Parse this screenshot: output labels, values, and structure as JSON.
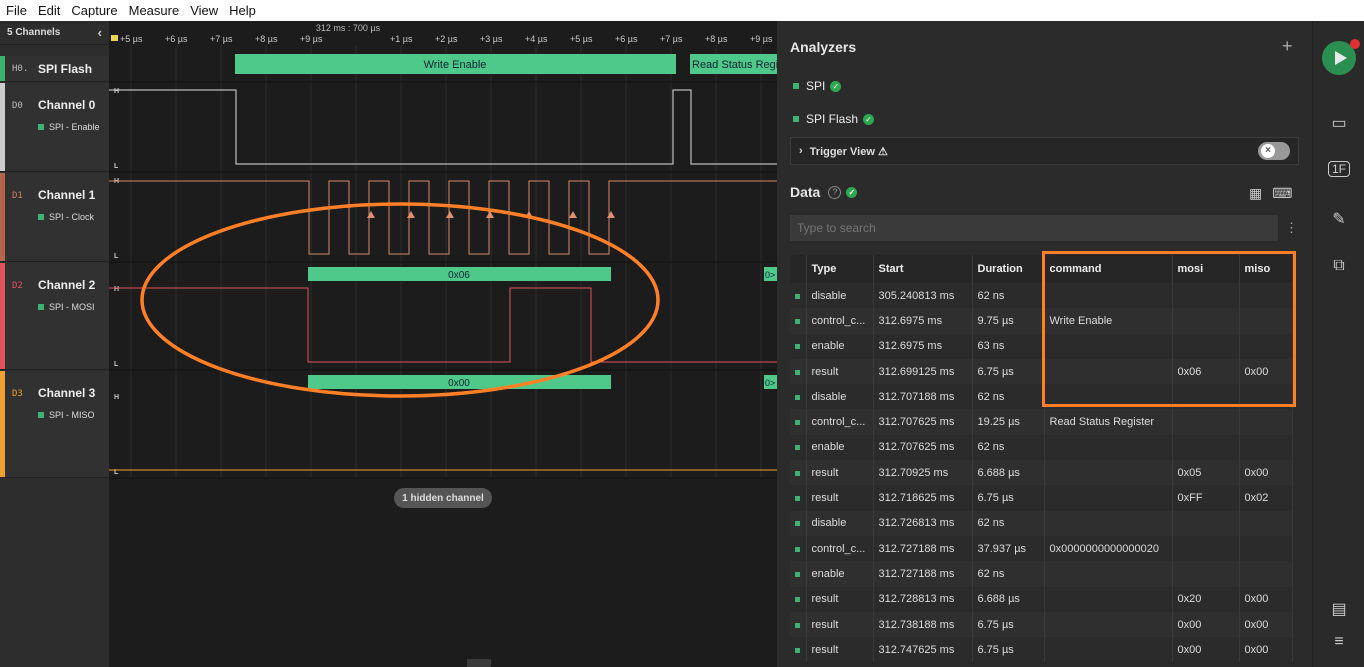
{
  "menu": [
    "File",
    "Edit",
    "Capture",
    "Measure",
    "View",
    "Help"
  ],
  "channels_panel": {
    "header": "5 Channels",
    "channels": [
      {
        "tag": "H0.",
        "name": "SPI Flash",
        "sub": "",
        "color": "#3cb371"
      },
      {
        "tag": "D0",
        "name": "Channel 0",
        "sub": "SPI - Enable",
        "color": "#cccccc"
      },
      {
        "tag": "D1",
        "name": "Channel 1",
        "sub": "SPI - Clock",
        "color": "#b5654a"
      },
      {
        "tag": "D2",
        "name": "Channel 2",
        "sub": "SPI - MOSI",
        "color": "#e0535d"
      },
      {
        "tag": "D3",
        "name": "Channel 3",
        "sub": "SPI - MISO",
        "color": "#f0a030"
      }
    ],
    "hidden": "1 hidden channel"
  },
  "timeline": {
    "center": "312 ms : 700 µs",
    "ticks": [
      "+5 µs",
      "+6 µs",
      "+7 µs",
      "+8 µs",
      "+9 µs",
      "+1 µs",
      "+2 µs",
      "+3 µs",
      "+4 µs",
      "+5 µs",
      "+6 µs",
      "+7 µs",
      "+8 µs",
      "+9 µs"
    ]
  },
  "waveform": {
    "flash_labels": [
      "Write Enable",
      "Read Status Regi"
    ],
    "mosi_label": "0x06",
    "miso_label": "0x00",
    "high_label": "H",
    "low_label": "L",
    "edge_label": "0>"
  },
  "analyzers": {
    "title": "Analyzers",
    "add": "+",
    "items": [
      "SPI",
      "SPI Flash"
    ],
    "trigger": "Trigger View ⚠"
  },
  "data": {
    "title": "Data",
    "search_placeholder": "Type to search",
    "columns": [
      "",
      "Type",
      "Start",
      "Duration",
      "command",
      "mosi",
      "miso"
    ],
    "rows": [
      [
        "disable",
        "305.240813 ms",
        "62 ns",
        "",
        "",
        ""
      ],
      [
        "control_c...",
        "312.6975 ms",
        "9.75 µs",
        "Write Enable",
        "",
        ""
      ],
      [
        "enable",
        "312.6975 ms",
        "63 ns",
        "",
        "",
        ""
      ],
      [
        "result",
        "312.699125 ms",
        "6.75 µs",
        "",
        "0x06",
        "0x00"
      ],
      [
        "disable",
        "312.707188 ms",
        "62 ns",
        "",
        "",
        ""
      ],
      [
        "control_c...",
        "312.707625 ms",
        "19.25 µs",
        "Read Status Register",
        "",
        ""
      ],
      [
        "enable",
        "312.707625 ms",
        "62 ns",
        "",
        "",
        ""
      ],
      [
        "result",
        "312.70925 ms",
        "6.688 µs",
        "",
        "0x05",
        "0x00"
      ],
      [
        "result",
        "312.718625 ms",
        "6.75 µs",
        "",
        "0xFF",
        "0x02"
      ],
      [
        "disable",
        "312.726813 ms",
        "62 ns",
        "",
        "",
        ""
      ],
      [
        "control_c...",
        "312.727188 ms",
        "37.937 µs",
        "0x0000000000000020",
        "",
        ""
      ],
      [
        "enable",
        "312.727188 ms",
        "62 ns",
        "",
        "",
        ""
      ],
      [
        "result",
        "312.728813 ms",
        "6.688 µs",
        "",
        "0x20",
        "0x00"
      ],
      [
        "result",
        "312.738188 ms",
        "6.75 µs",
        "",
        "0x00",
        "0x00"
      ],
      [
        "result",
        "312.747625 ms",
        "6.75 µs",
        "",
        "0x00",
        "0x00"
      ]
    ]
  },
  "colors": {
    "accent": "#3cb371",
    "annotation": "#ff7f27"
  }
}
